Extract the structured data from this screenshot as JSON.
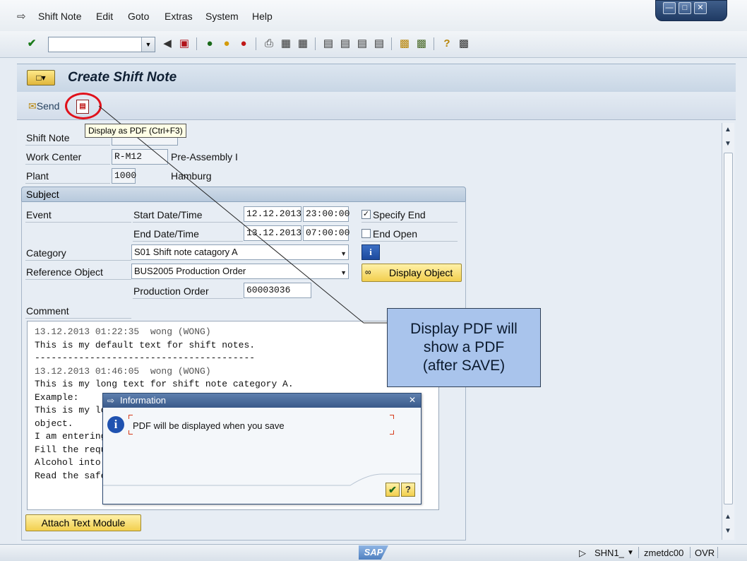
{
  "menu": {
    "items": [
      "Shift Note",
      "Edit",
      "Goto",
      "Extras",
      "System",
      "Help"
    ]
  },
  "toolbar": {
    "command_value": ""
  },
  "title": "Create Shift Note",
  "app_toolbar": {
    "send_label": "Send",
    "tooltip": "Display as PDF   (Ctrl+F3)"
  },
  "header_fields": {
    "shift_note_label": "Shift Note",
    "work_center_label": "Work Center",
    "work_center_value": "R-M12",
    "work_center_desc": "Pre-Assembly I",
    "plant_label": "Plant",
    "plant_value": "1000",
    "plant_desc": "Hamburg"
  },
  "subject": {
    "heading": "Subject",
    "event_label": "Event",
    "start_label": "Start Date/Time",
    "start_date": "12.12.2013",
    "start_time": "23:00:00",
    "end_label": "End Date/Time",
    "end_date": "13.12.2013",
    "end_time": "07:00:00",
    "specify_end_label": "Specify End",
    "specify_end_checked": true,
    "end_open_label": "End Open",
    "end_open_checked": false,
    "category_label": "Category",
    "category_value": "S01 Shift note catagory A",
    "reference_label": "Reference Object",
    "reference_value": "BUS2005 Production Order",
    "display_object_label": "Display Object",
    "production_order_label": "Production Order",
    "production_order_value": "60003036",
    "comment_label": "Comment",
    "attach_button": "Attach Text Module"
  },
  "comment_lines": [
    "13.12.2013 01:22:35  wong (WONG)",
    "This is my default text for shift notes.",
    "----------------------------------------",
    "13.12.2013 01:46:05  wong (WONG)",
    "This is my long text for shift note category A.",
    "Example:",
    "This is my lo",
    "object.",
    "I am entering",
    "Fill the requ",
    "Alcohol into",
    "Read the safe"
  ],
  "callout": {
    "line1": "Display PDF will",
    "line2": "show a PDF",
    "line3": "(after SAVE)"
  },
  "dialog": {
    "title": "Information",
    "message": "PDF will be displayed when you save"
  },
  "status": {
    "session": "SHN1_",
    "server": "zmetdc00",
    "mode": "OVR"
  },
  "colors": {
    "callout_fill": "#a9c4ec",
    "highlight_circle": "#e0111b",
    "dialog_title": "#39598a"
  }
}
